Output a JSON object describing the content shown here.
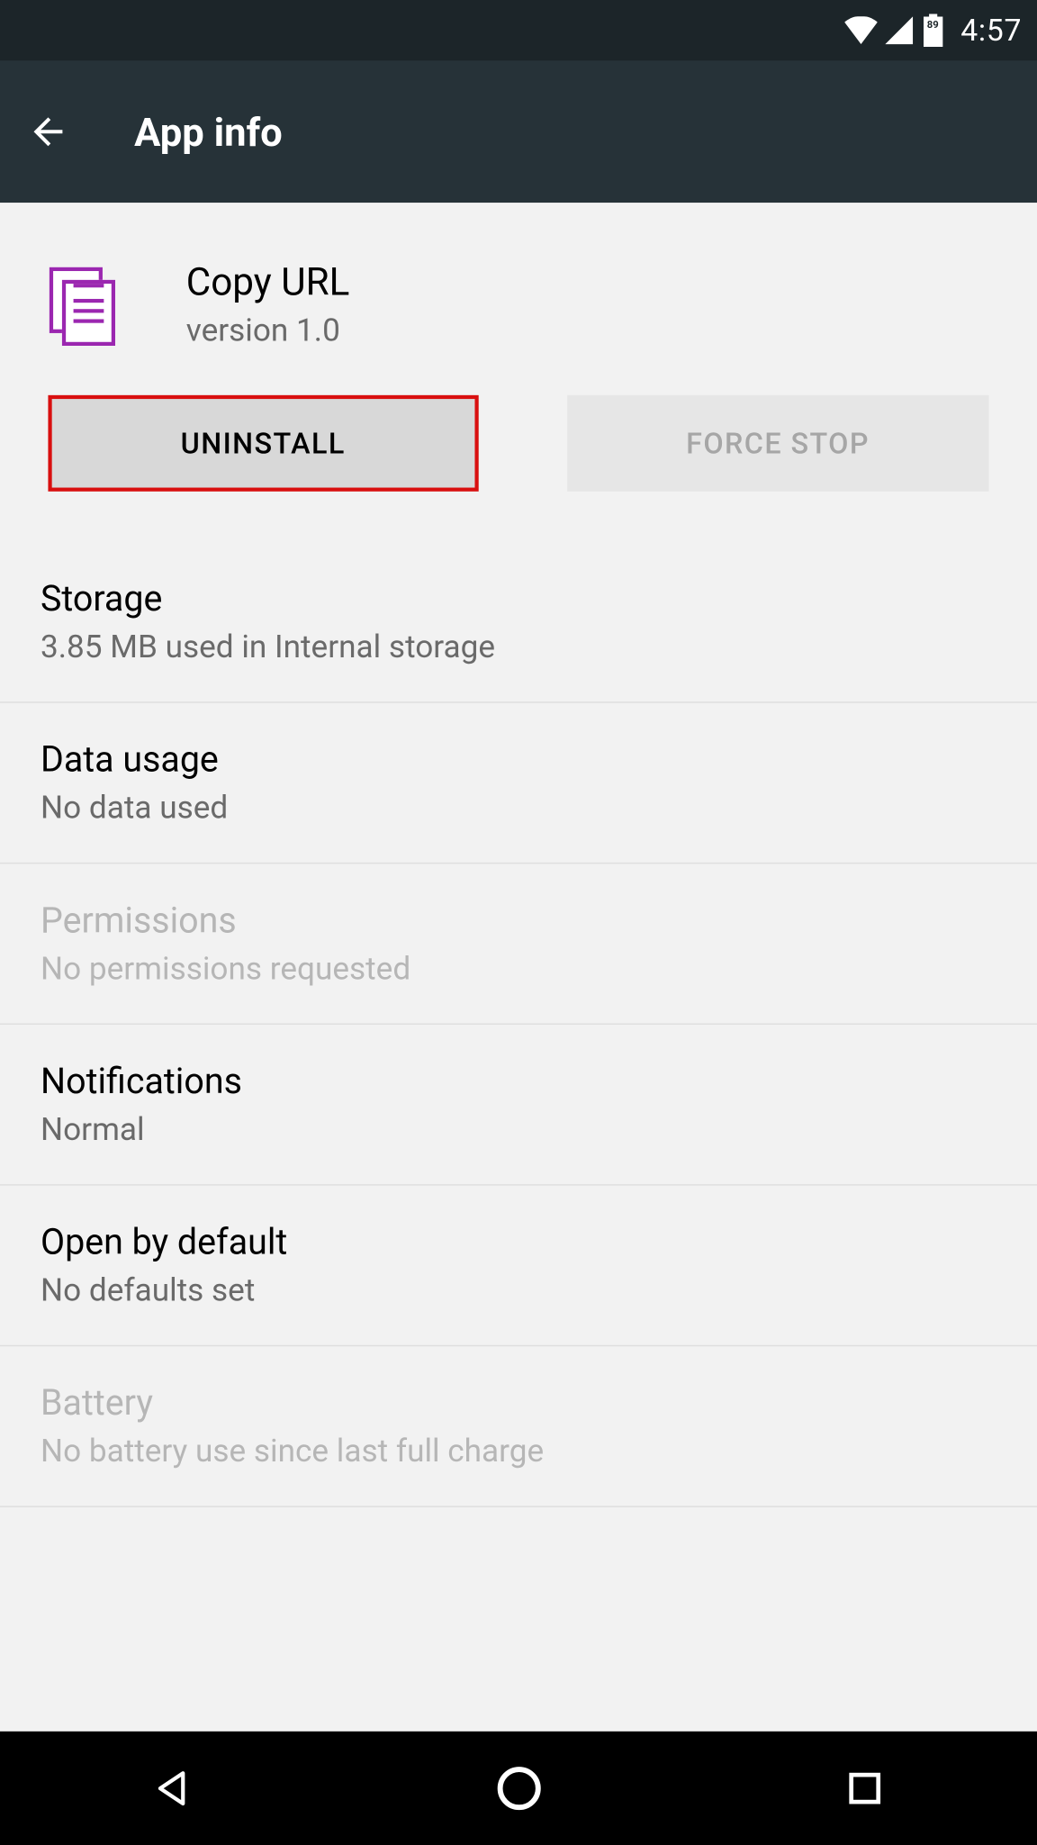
{
  "status_bar": {
    "battery_pct": "89",
    "time": "4:57"
  },
  "action_bar": {
    "title": "App info"
  },
  "app": {
    "name": "Copy URL",
    "version": "version 1.0"
  },
  "buttons": {
    "uninstall": "UNINSTALL",
    "force_stop": "FORCE STOP"
  },
  "items": {
    "storage": {
      "title": "Storage",
      "subtitle": "3.85 MB used in Internal storage"
    },
    "data_usage": {
      "title": "Data usage",
      "subtitle": "No data used"
    },
    "permissions": {
      "title": "Permissions",
      "subtitle": "No permissions requested"
    },
    "notifications": {
      "title": "Notifications",
      "subtitle": "Normal"
    },
    "open_default": {
      "title": "Open by default",
      "subtitle": "No defaults set"
    },
    "battery": {
      "title": "Battery",
      "subtitle": "No battery use since last full charge"
    }
  }
}
